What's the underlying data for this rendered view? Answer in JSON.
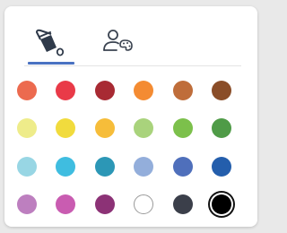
{
  "tabs": [
    {
      "id": "fill",
      "icon": "paint-bucket-icon",
      "active": true
    },
    {
      "id": "style",
      "icon": "user-palette-icon",
      "active": false
    }
  ],
  "colors": {
    "accent": "#4a72c2",
    "rows": [
      [
        "#ec6a4f",
        "#e93a48",
        "#a82a33",
        "#f48b32",
        "#bf6d3a",
        "#8a4d28"
      ],
      [
        "#eeec8a",
        "#f1db3d",
        "#f6bd3a",
        "#a9d37c",
        "#7cc04b",
        "#4f9b47"
      ],
      [
        "#98d6e4",
        "#3fbde0",
        "#2c97b6",
        "#93aedb",
        "#4f6fbb",
        "#245eac"
      ],
      [
        "#bd7fbf",
        "#c95cb1",
        "#8c3276",
        "#ffffff",
        "#3b3f4a",
        "#000000"
      ]
    ],
    "selected": [
      3,
      5
    ]
  }
}
